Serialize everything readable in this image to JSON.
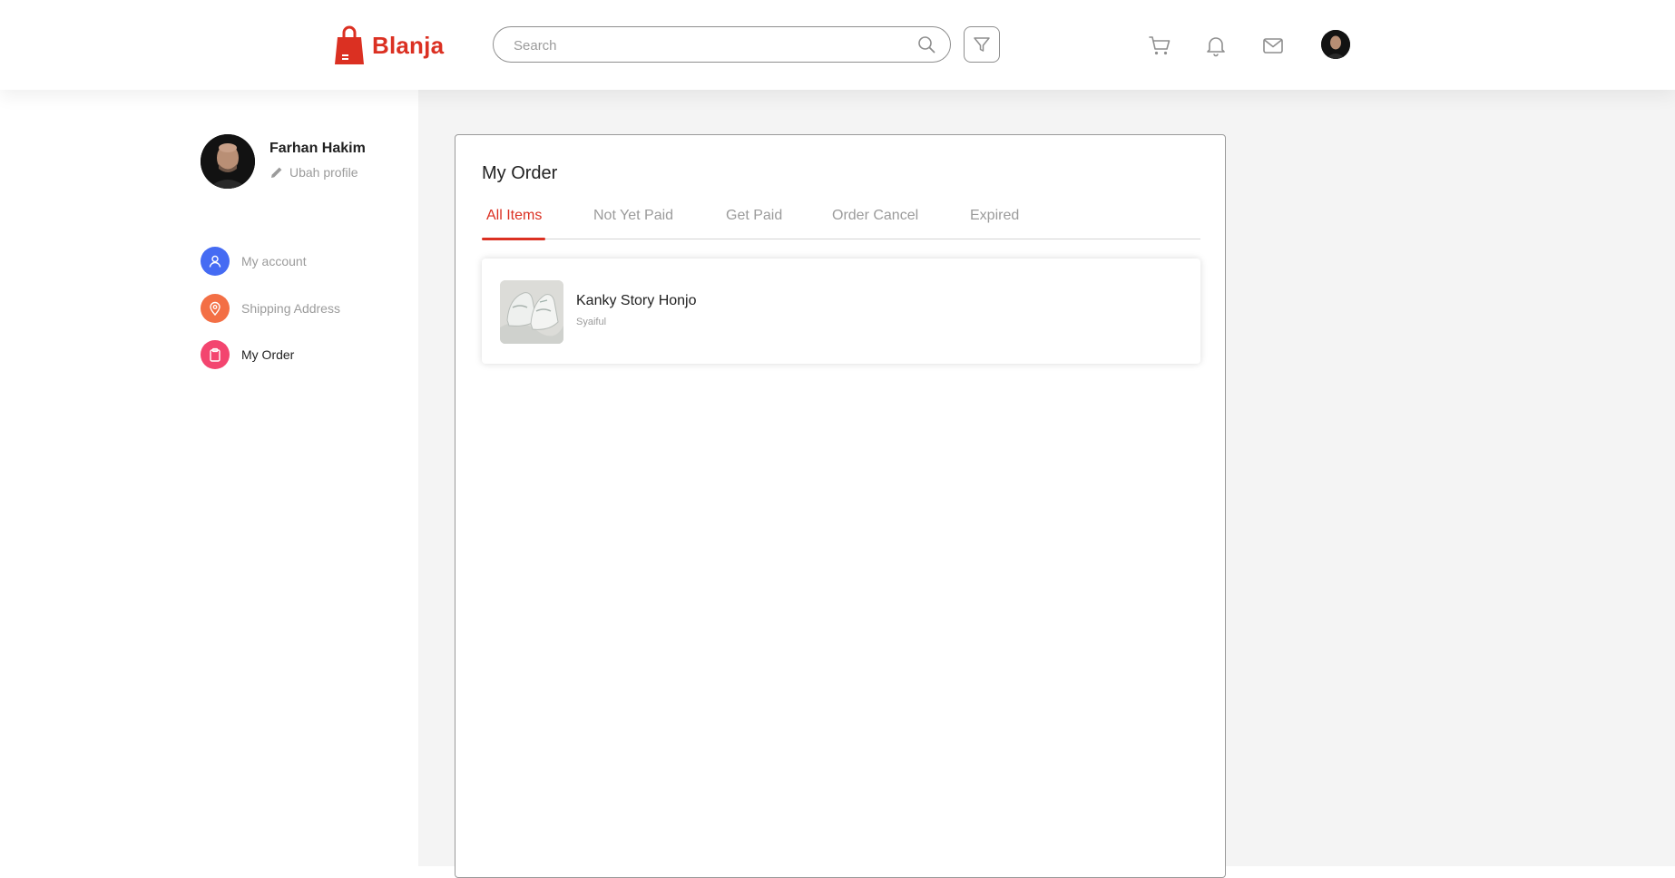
{
  "brand": {
    "name": "Blanja",
    "accent_color": "#DB3022"
  },
  "header": {
    "search_placeholder": "Search",
    "icons": [
      "search-icon",
      "filter-icon",
      "cart-icon",
      "bell-icon",
      "mail-icon",
      "avatar"
    ]
  },
  "profile": {
    "name": "Farhan Hakim",
    "edit_label": "Ubah profile"
  },
  "sidebar": {
    "items": [
      {
        "label": "My account",
        "icon": "user-icon",
        "color": "#456BF3",
        "active": false
      },
      {
        "label": "Shipping Address",
        "icon": "location-pin-icon",
        "color": "#F36F45",
        "active": false
      },
      {
        "label": "My Order",
        "icon": "clipboard-icon",
        "color": "#F3456F",
        "active": true
      }
    ]
  },
  "main": {
    "title": "My Order",
    "tabs": [
      {
        "label": "All Items",
        "active": true
      },
      {
        "label": "Not Yet Paid",
        "active": false
      },
      {
        "label": "Get Paid",
        "active": false
      },
      {
        "label": "Order Cancel",
        "active": false
      },
      {
        "label": "Expired",
        "active": false
      }
    ],
    "orders": [
      {
        "name": "Kanky Story Honjo",
        "store": "Syaiful",
        "image": "sneaker-photo"
      }
    ]
  }
}
